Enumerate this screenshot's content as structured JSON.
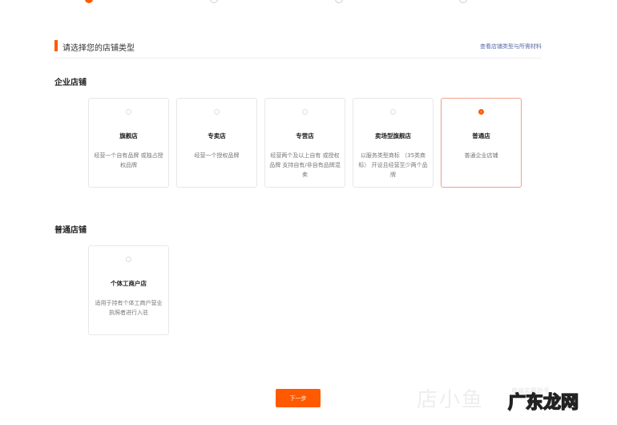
{
  "steps": [
    {
      "active": true
    },
    {
      "active": false
    },
    {
      "active": false
    },
    {
      "active": false
    }
  ],
  "section": {
    "title": "请选择您的店铺类型",
    "link": "查看店铺类型与所需材料"
  },
  "groups": [
    {
      "label": "企业店铺",
      "cards": [
        {
          "title": "旗舰店",
          "desc": "经营一个自有品牌 或独占授权品牌",
          "selected": false
        },
        {
          "title": "专卖店",
          "desc": "经营一个授权品牌",
          "selected": false
        },
        {
          "title": "专营店",
          "desc": "经营两个及以上自有 或授权品牌 支持自有/非自有品牌混卖",
          "selected": false
        },
        {
          "title": "卖场型旗舰店",
          "desc": "以服务类型商标 （35类商标） 开设且经营至少两个品牌",
          "selected": false
        },
        {
          "title": "普通店",
          "desc": "普通企业店铺",
          "selected": true
        }
      ]
    },
    {
      "label": "普通店铺",
      "cards": [
        {
          "title": "个体工商户店",
          "desc": "适用于持有个体工商户营业执照者进行入驻",
          "selected": false
        }
      ]
    }
  ],
  "next_button": "下一步",
  "watermark": {
    "brand": "店小鱼",
    "tagline": "电商实用助手",
    "site": "广东龙网"
  },
  "colors": {
    "accent": "#ff5a00",
    "link": "#5a6aa8"
  }
}
